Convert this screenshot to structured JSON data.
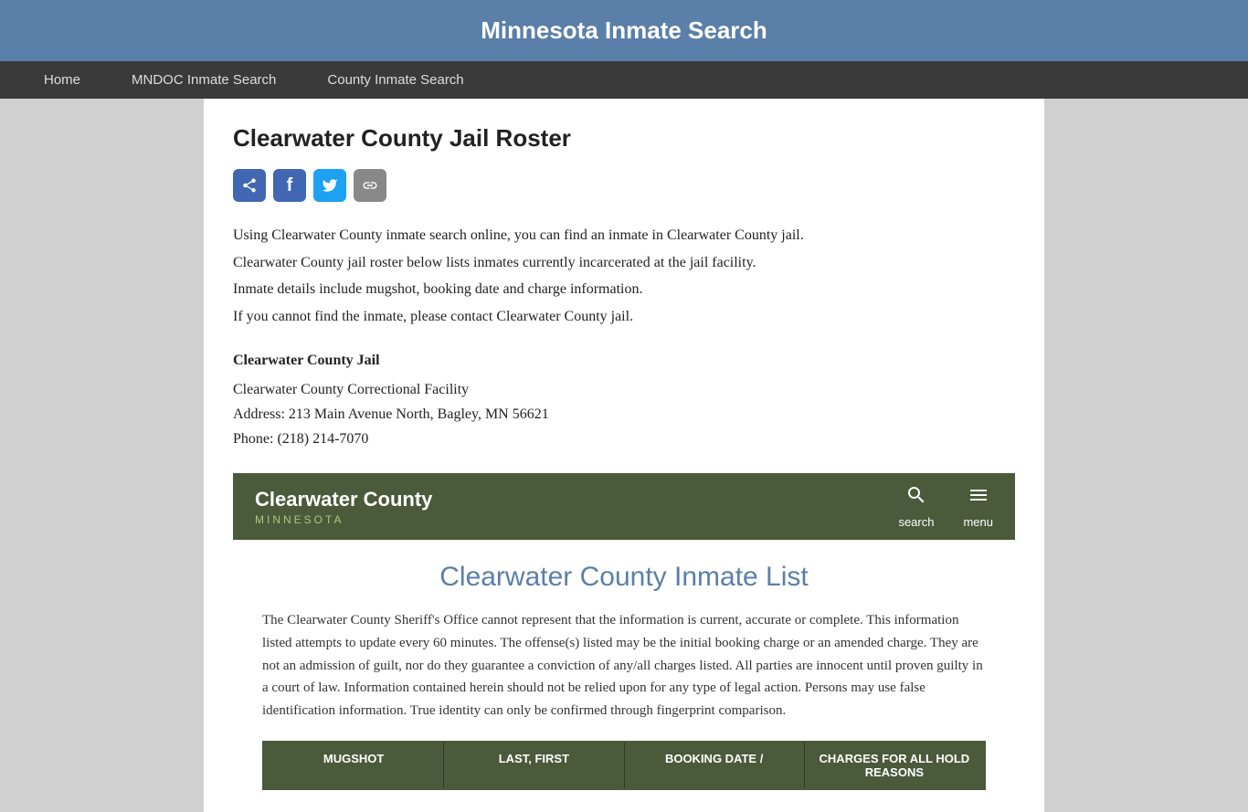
{
  "site": {
    "title": "Minnesota Inmate Search"
  },
  "nav": {
    "items": [
      {
        "label": "Home",
        "id": "home"
      },
      {
        "label": "MNDOC Inmate Search",
        "id": "mndoc"
      },
      {
        "label": "County Inmate Search",
        "id": "county"
      }
    ]
  },
  "page": {
    "title": "Clearwater County Jail Roster",
    "description_lines": [
      "Using Clearwater County inmate search online, you can find an inmate in Clearwater County jail.",
      "Clearwater County jail roster below lists inmates currently incarcerated at the jail facility.",
      "Inmate details include mugshot, booking date and charge information.",
      "If you cannot find the inmate, please contact Clearwater County jail."
    ],
    "jail": {
      "name": "Clearwater County Jail",
      "facility": "Clearwater County Correctional Facility",
      "address": "Address: 213 Main Avenue North, Bagley, MN 56621",
      "phone": "Phone: (218) 214-7070"
    }
  },
  "county_widget": {
    "title": "Clearwater County",
    "subtitle": "MINNESOTA",
    "search_label": "search",
    "menu_label": "menu"
  },
  "inmate_section": {
    "title": "Clearwater County Inmate List",
    "disclaimer": "The Clearwater County Sheriff's Office cannot represent that the information is current, accurate or complete. This information listed attempts to update every 60 minutes. The offense(s) listed may be the initial booking charge or an amended charge. They are not an admission of guilt, nor do they guarantee a conviction of any/all charges listed. All parties are innocent until proven guilty in a court of law. Information contained herein should not be relied upon for any type of legal action. Persons may use false identification information. True identity can only be confirmed through fingerprint comparison.",
    "table_columns": [
      "MUGSHOT",
      "LAST, FIRST",
      "BOOKING DATE /",
      "CHARGES FOR ALL HOLD REASONS"
    ]
  },
  "social": {
    "share_title": "Share",
    "facebook_title": "Facebook",
    "twitter_title": "Twitter",
    "link_title": "Copy Link"
  }
}
